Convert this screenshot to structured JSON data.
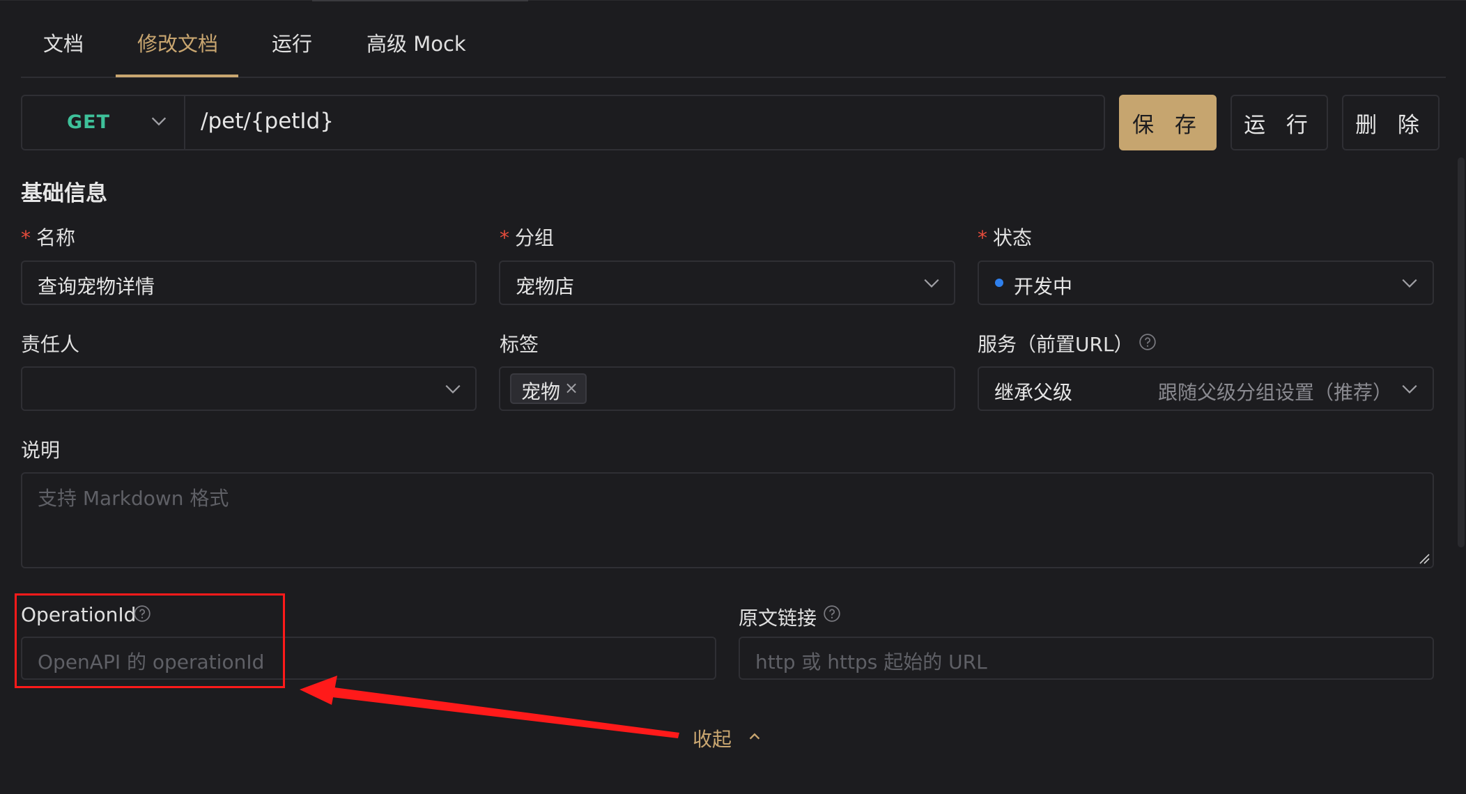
{
  "tabs": [
    {
      "label": "文档"
    },
    {
      "label": "修改文档"
    },
    {
      "label": "运行"
    },
    {
      "label": "高级 Mock"
    }
  ],
  "request": {
    "method": "GET",
    "path": "/pet/{petId}"
  },
  "buttons": {
    "save": "保 存",
    "run": "运 行",
    "delete": "删 除"
  },
  "basic_info": {
    "title": "基础信息",
    "name": {
      "label": "名称",
      "required": "*",
      "value": "查询宠物详情"
    },
    "group": {
      "label": "分组",
      "required": "*",
      "value": "宠物店"
    },
    "status": {
      "label": "状态",
      "required": "*",
      "value": "开发中",
      "dot_color": "#2f80ed"
    },
    "owner": {
      "label": "责任人",
      "value": ""
    },
    "tags": {
      "label": "标签",
      "items": [
        "宠物"
      ],
      "remove_glyph": "×"
    },
    "service": {
      "label": "服务（前置URL）",
      "value": "继承父级",
      "hint": "跟随父级分组设置（推荐）"
    },
    "description": {
      "label": "说明",
      "placeholder": "支持 Markdown 格式"
    },
    "operation_id": {
      "label": "OperationId",
      "placeholder": "OpenAPI 的 operationId"
    },
    "source_link": {
      "label": "原文链接",
      "placeholder": "http 或 https 起始的 URL"
    }
  },
  "collapse": {
    "label": "收起"
  },
  "colors": {
    "accent": "#c9a670",
    "method_get": "#3ec19a",
    "required_star": "#e74c3c",
    "highlight_box": "#ff1a1a",
    "background": "#1c1c1f"
  }
}
